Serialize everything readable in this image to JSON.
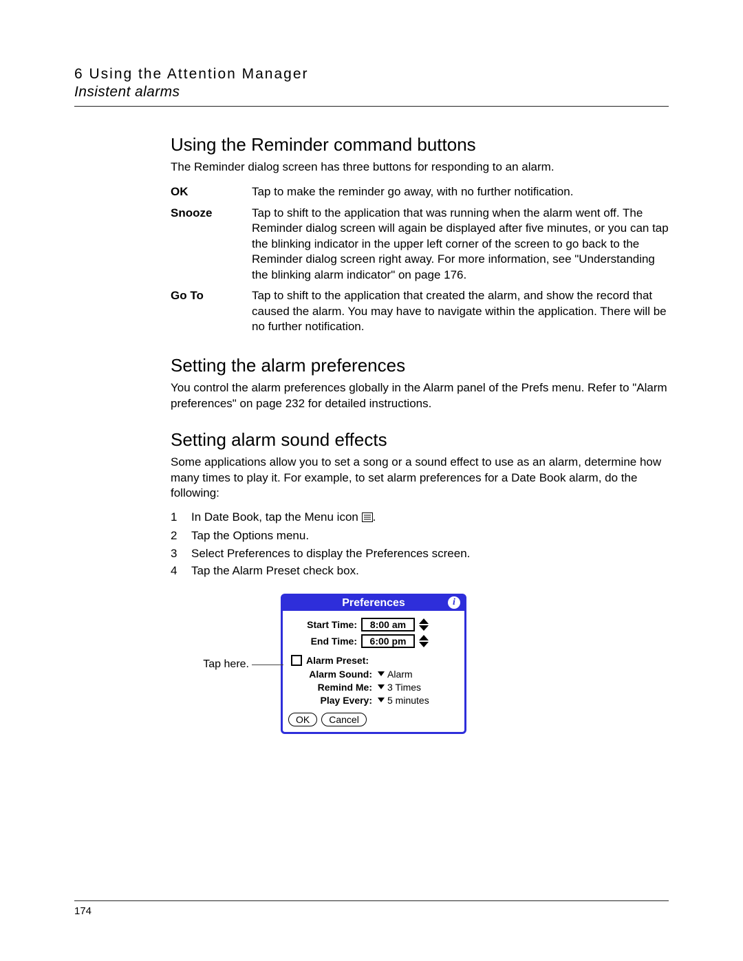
{
  "header": {
    "chapter": "6 Using the Attention Manager",
    "section": "Insistent alarms"
  },
  "sec1": {
    "title": "Using the Reminder command buttons",
    "intro": "The Reminder dialog screen has three buttons for responding to an alarm.",
    "rows": [
      {
        "term": "OK",
        "desc": "Tap to make the reminder go away, with no further notification."
      },
      {
        "term": "Snooze",
        "desc": "Tap to shift to the application that was running when the alarm went off. The Reminder dialog screen will again be displayed after five minutes, or you can tap the blinking indicator in the upper left corner of the screen to go back to the Reminder dialog screen right away. For more information, see \"Understanding the blinking alarm indicator\" on page 176."
      },
      {
        "term": "Go To",
        "desc": "Tap to shift to the application that created the alarm, and show the record that caused the alarm. You may have to navigate within the application. There will be no further notification."
      }
    ]
  },
  "sec2": {
    "title": "Setting the alarm preferences",
    "body": "You control the alarm preferences globally in the Alarm panel of the Prefs menu. Refer to \"Alarm preferences\" on page 232 for detailed instructions."
  },
  "sec3": {
    "title": "Setting alarm sound effects",
    "body": "Some applications allow you to set a song or a sound effect to use as an alarm, determine how many times to play it. For example, to set alarm preferences for a Date Book alarm, do the following:",
    "steps": [
      "In Date Book, tap the Menu icon",
      "Tap the Options menu.",
      "Select Preferences to display the Preferences screen.",
      "Tap the Alarm Preset check box."
    ],
    "step1_suffix": "."
  },
  "figure": {
    "callout": "Tap here.",
    "title": "Preferences",
    "start_label": "Start Time:",
    "start_value": "8:00 am",
    "end_label": "End Time:",
    "end_value": "6:00 pm",
    "preset_label": "Alarm Preset:",
    "sound_label": "Alarm Sound:",
    "sound_value": "Alarm",
    "remind_label": "Remind Me:",
    "remind_value": "3 Times",
    "play_label": "Play Every:",
    "play_value": "5 minutes",
    "ok": "OK",
    "cancel": "Cancel"
  },
  "page_number": "174"
}
